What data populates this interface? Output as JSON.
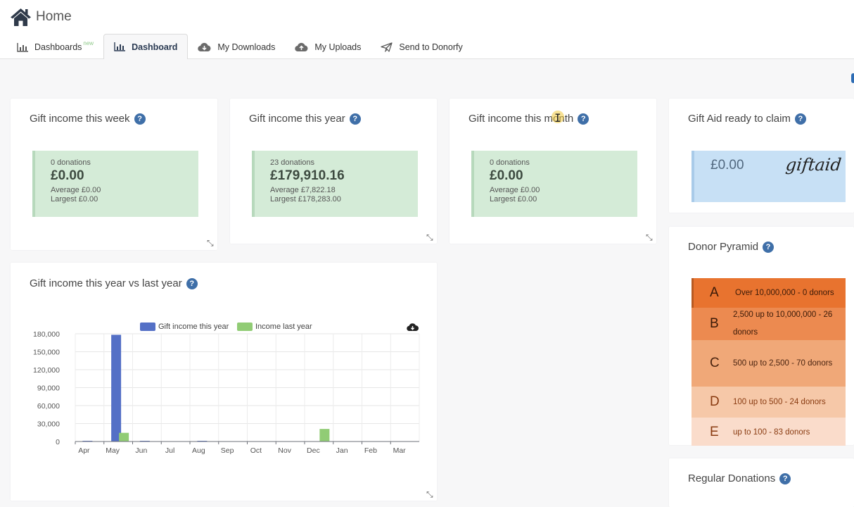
{
  "header": {
    "title": "Home"
  },
  "tabs": [
    {
      "label": "Dashboards",
      "badge": "new",
      "icon": "bar-chart-icon"
    },
    {
      "label": "Dashboard",
      "icon": "bar-chart-icon",
      "active": true
    },
    {
      "label": "My Downloads",
      "icon": "cloud-download-icon"
    },
    {
      "label": "My Uploads",
      "icon": "cloud-upload-icon"
    },
    {
      "label": "Send to Donorfy",
      "icon": "paper-plane-icon"
    }
  ],
  "widgets": {
    "week": {
      "title": "Gift income this week",
      "count": "0 donations",
      "amount": "£0.00",
      "average": "Average £0.00",
      "largest": "Largest £0.00"
    },
    "year": {
      "title": "Gift income this year",
      "count": "23 donations",
      "amount": "£179,910.16",
      "average": "Average £7,822.18",
      "largest": "Largest £178,283.00"
    },
    "month": {
      "title": "Gift income this month",
      "count": "0 donations",
      "amount": "£0.00",
      "average": "Average £0.00",
      "largest": "Largest £0.00"
    },
    "giftaid": {
      "title": "Gift Aid ready to claim",
      "amount": "£0.00",
      "logo_text": "giftaid"
    },
    "pyramid": {
      "title": "Donor Pyramid",
      "rows": [
        {
          "letter": "A",
          "text": "Over 10,000,000 - 0 donors",
          "bg": "#e8732f",
          "fg": "#3a1a08"
        },
        {
          "letter": "B",
          "text": "2,500 up to 10,000,000 - 26 donors",
          "bg": "#ec8a50",
          "fg": "#3a1a08"
        },
        {
          "letter": "C",
          "text": "500 up to 2,500 - 70 donors",
          "bg": "#f0a878",
          "fg": "#4a2410"
        },
        {
          "letter": "D",
          "text": "100 up to 500 - 24 donors",
          "bg": "#f6c8a8",
          "fg": "#8a3c12"
        },
        {
          "letter": "E",
          "text": "up to 100 - 83 donors",
          "bg": "#fadccb",
          "fg": "#8a3c12"
        }
      ]
    },
    "regular": {
      "title": "Regular Donations"
    },
    "comparison": {
      "title": "Gift income this year vs last year"
    }
  },
  "chart_data": {
    "type": "bar",
    "categories": [
      "Apr",
      "May",
      "Jun",
      "Jul",
      "Aug",
      "Sep",
      "Oct",
      "Nov",
      "Dec",
      "Jan",
      "Feb",
      "Mar"
    ],
    "series": [
      {
        "name": "Gift income this year",
        "color": "#5470c6",
        "values": [
          1200,
          178283,
          400,
          0,
          300,
          0,
          0,
          0,
          0,
          0,
          0,
          0
        ]
      },
      {
        "name": "Income last year",
        "color": "#91cc75",
        "values": [
          0,
          14500,
          0,
          0,
          0,
          0,
          0,
          0,
          21000,
          0,
          0,
          0
        ]
      }
    ],
    "yticks": [
      "0",
      "30,000",
      "60,000",
      "90,000",
      "120,000",
      "150,000",
      "180,000"
    ],
    "ylim": [
      0,
      180000
    ],
    "legend": "top",
    "grid": true
  }
}
